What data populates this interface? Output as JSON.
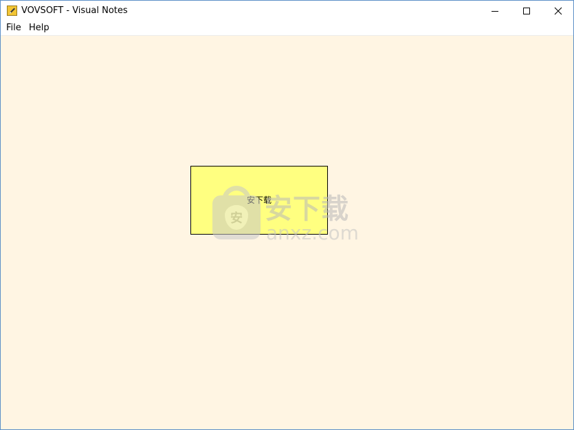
{
  "window": {
    "title": "VOVSOFT - Visual Notes",
    "icon": "pencil-note-icon",
    "controls": [
      "minimize-icon",
      "maximize-icon",
      "close-icon"
    ]
  },
  "menu": {
    "items": [
      {
        "label": "File"
      },
      {
        "label": "Help"
      }
    ]
  },
  "canvas": {
    "background": "#fff5e3",
    "notes": [
      {
        "text": "安下载",
        "color": "#ffff80",
        "border": "#000000"
      }
    ]
  },
  "watermark": {
    "brand_cn": "安下载",
    "brand_en": "anxz.com",
    "logo_glyph": "安"
  }
}
